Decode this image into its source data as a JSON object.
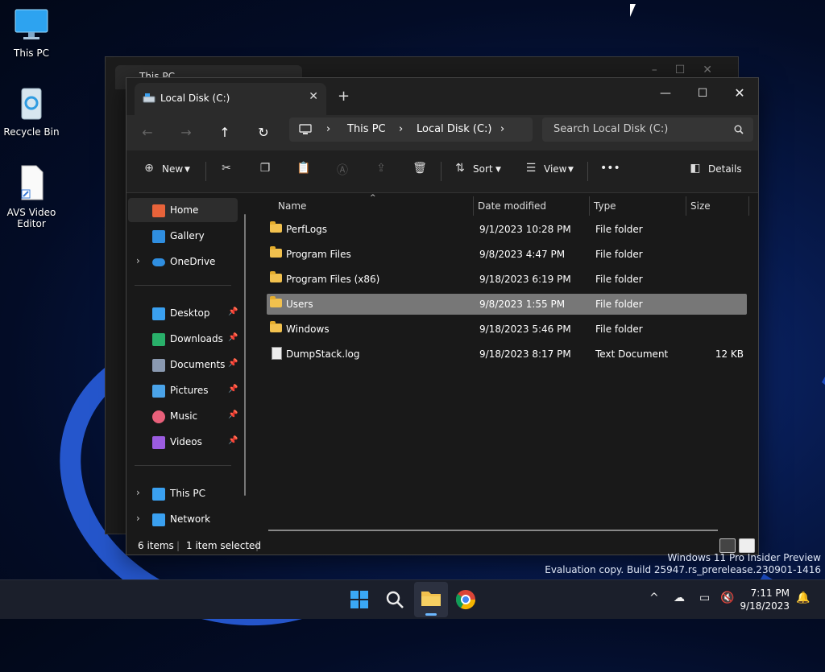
{
  "desktop": {
    "icons": [
      {
        "label": "This PC"
      },
      {
        "label": "Recycle Bin"
      },
      {
        "label": "AVS Video Editor"
      }
    ]
  },
  "background_window": {
    "tab_title": "This PC"
  },
  "window": {
    "tab_title": "Local Disk (C:)",
    "breadcrumbs": [
      "This PC",
      "Local Disk (C:)"
    ],
    "search_placeholder": "Search Local Disk (C:)",
    "toolbar": {
      "new_label": "New",
      "sort_label": "Sort",
      "view_label": "View",
      "more_label": "•••",
      "details_label": "Details"
    },
    "sidebar": {
      "items": [
        {
          "label": "Home",
          "icon": "home-icon",
          "color": "#e8633a"
        },
        {
          "label": "Gallery",
          "icon": "gallery-icon",
          "color": "#2f8ee0"
        },
        {
          "label": "OneDrive",
          "icon": "cloud-icon",
          "color": "#2f8ee0"
        },
        {
          "label": "Desktop",
          "icon": "desktop-icon",
          "color": "#3aa0f0"
        },
        {
          "label": "Downloads",
          "icon": "download-icon",
          "color": "#29b06a"
        },
        {
          "label": "Documents",
          "icon": "document-icon",
          "color": "#8a99b0"
        },
        {
          "label": "Pictures",
          "icon": "pictures-icon",
          "color": "#4aa3e8"
        },
        {
          "label": "Music",
          "icon": "music-icon",
          "color": "#e8607a"
        },
        {
          "label": "Videos",
          "icon": "videos-icon",
          "color": "#9b5ce0"
        },
        {
          "label": "This PC",
          "icon": "computer-icon",
          "color": "#3aa0f0"
        },
        {
          "label": "Network",
          "icon": "network-icon",
          "color": "#3aa0f0"
        }
      ]
    },
    "columns": {
      "name": "Name",
      "date": "Date modified",
      "type": "Type",
      "size": "Size"
    },
    "files": [
      {
        "name": "PerfLogs",
        "date": "9/1/2023 10:28 PM",
        "type": "File folder",
        "size": ""
      },
      {
        "name": "Program Files",
        "date": "9/8/2023 4:47 PM",
        "type": "File folder",
        "size": ""
      },
      {
        "name": "Program Files (x86)",
        "date": "9/18/2023 6:19 PM",
        "type": "File folder",
        "size": ""
      },
      {
        "name": "Users",
        "date": "9/8/2023 1:55 PM",
        "type": "File folder",
        "size": ""
      },
      {
        "name": "Windows",
        "date": "9/18/2023 5:46 PM",
        "type": "File folder",
        "size": ""
      },
      {
        "name": "DumpStack.log",
        "date": "9/18/2023 8:17 PM",
        "type": "Text Document",
        "size": "12 KB"
      }
    ],
    "status": {
      "count": "6 items",
      "selected": "1 item selected"
    }
  },
  "watermark": {
    "line1": "Windows 11 Pro Insider Preview",
    "line2": "Evaluation copy. Build 25947.rs_prerelease.230901-1416"
  },
  "taskbar": {
    "time": "7:11 PM",
    "date": "9/18/2023"
  }
}
